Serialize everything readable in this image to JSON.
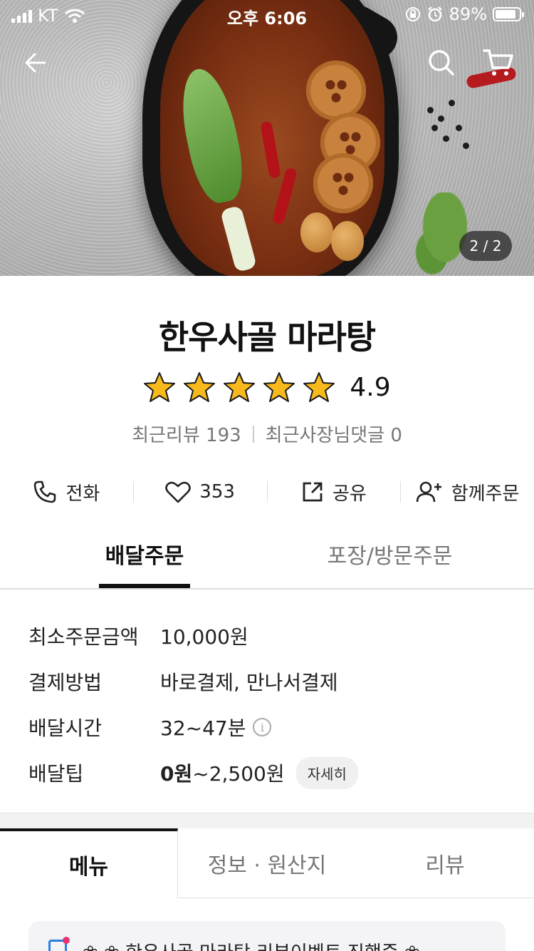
{
  "status_bar": {
    "carrier": "KT",
    "time": "오후 6:06",
    "battery": "89%",
    "battery_level": 0.89
  },
  "hero": {
    "pager": "2 / 2"
  },
  "store": {
    "name": "한우사골 마라탕",
    "rating_value": "4.9",
    "stars": 5,
    "reviews_label": "최근리뷰 193",
    "owner_comments_label": "최근사장님댓글 0"
  },
  "actions": {
    "call": "전화",
    "likes": "353",
    "share": "공유",
    "group_order": "함께주문"
  },
  "order_tabs": {
    "delivery": "배달주문",
    "pickup": "포장/방문주문"
  },
  "info": {
    "min_order_label": "최소주문금액",
    "min_order_value": "10,000원",
    "payment_label": "결제방법",
    "payment_value": "바로결제, 만나서결제",
    "time_label": "배달시간",
    "time_value": "32~47분",
    "tip_label": "배달팁",
    "tip_min": "0원",
    "tip_range": "~2,500원",
    "tip_detail": "자세히"
  },
  "content_tabs": {
    "menu": "메뉴",
    "info": "정보 · 원산지",
    "review": "리뷰"
  },
  "notice": {
    "text": "❀ ❀ 한우사골 마라탕 리뷰이벤트 진행중 ❀"
  },
  "colors": {
    "star": "#f7b91b",
    "notice_icon": "#2a7de1",
    "notice_dot": "#e8336e"
  }
}
